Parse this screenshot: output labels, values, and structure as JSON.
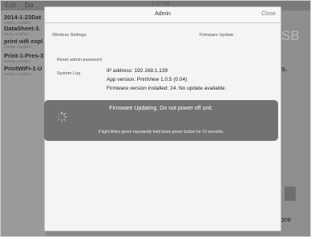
{
  "background": {
    "edit_label": "Edit",
    "doc_label": "Do",
    "clock": "1:10 PM",
    "items": [
      {
        "title": "2014-1-23Dat",
        "sub": "160KB, modified"
      },
      {
        "title": "DataSheet-3.",
        "sub": "95KB, modified"
      },
      {
        "title": "print wifi expl",
        "sub": "120KB, modified"
      },
      {
        "title": "Print-1-Pres-3",
        "sub": "210KB, modified"
      },
      {
        "title": "PrintWiFi-1-U",
        "sub": "180KB, modified"
      }
    ],
    "right_text": "SB",
    "right_s": "s.",
    "right_ore": "ore"
  },
  "modal": {
    "title": "Admin",
    "close_label": "Close",
    "tabs": {
      "wireless": "Wireless Settings",
      "firmware": "Firmware Update"
    },
    "reset_label": "Reset admin password",
    "log_label": "System Log",
    "ip": "IP address: 192.168.1.139",
    "app_version": "App version: PrintView 1.0.5 (0.04)",
    "firmware": "Firmware version installed: 24.  No update available."
  },
  "overlay": {
    "title": "Firmware Updating.  Do not power off unit.",
    "note": "If light blinks green repeatedly hold down power button for 10 seconds."
  },
  "colors": {
    "overlay_bg": "#727272",
    "modal_bg": "#f4f4f4",
    "dim_bg": "#8a8a8a"
  },
  "icons": {
    "spinner": "activity-spinner-icon"
  }
}
